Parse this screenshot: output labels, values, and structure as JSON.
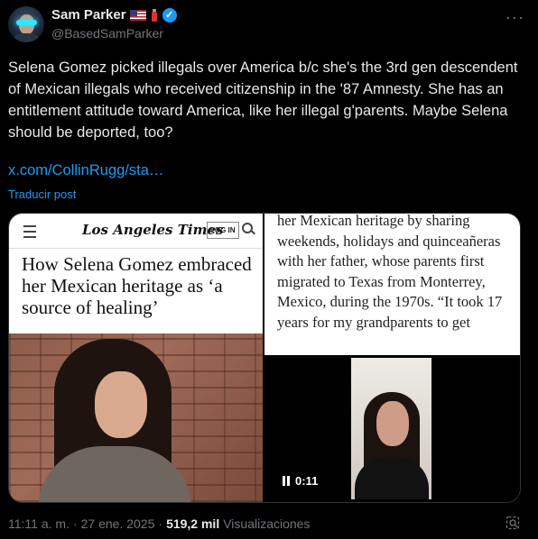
{
  "author": {
    "display_name": "Sam Parker",
    "handle": "@BasedSamParker",
    "name_emoji_flag": "us-flag",
    "name_emoji_extinguisher": "fire-extinguisher"
  },
  "tweet": {
    "text": "Selena Gomez picked illegals over America b/c she's the 3rd gen descendent of Mexican illegals who received citizenship in the '87 Amnesty. She has an entitlement attitude toward America, like her illegal g'parents. Maybe Selena should be deported, too?",
    "link_text": "x.com/CollinRugg/sta…",
    "translate_label": "Traducir post"
  },
  "media": {
    "lat_logo": "Los Angeles Times",
    "lat_login": "LOG IN",
    "lat_headline": "How Selena Gomez embraced her Mexican heritage as ‘a source of healing’",
    "article_excerpt": "her Mexican heritage by sharing weekends, holidays and quinceañeras with her father, whose parents first migrated to Texas from Monterrey, Mexico, during the 1970s. “It took 17 years for my grandparents to get",
    "video_time": "0:11"
  },
  "meta": {
    "time": "11:11 a. m.",
    "sep1": "·",
    "date": "27 ene. 2025",
    "sep2": "·",
    "views_count": "519,2 mil",
    "views_label": "Visualizaciones"
  },
  "icons": {
    "more": "more-icon",
    "verified": "verified-badge-icon",
    "grok": "grok-icon"
  },
  "colors": {
    "background": "#000000",
    "text": "#e7e9ea",
    "secondary": "#71767b",
    "accent": "#1d9bf0"
  }
}
